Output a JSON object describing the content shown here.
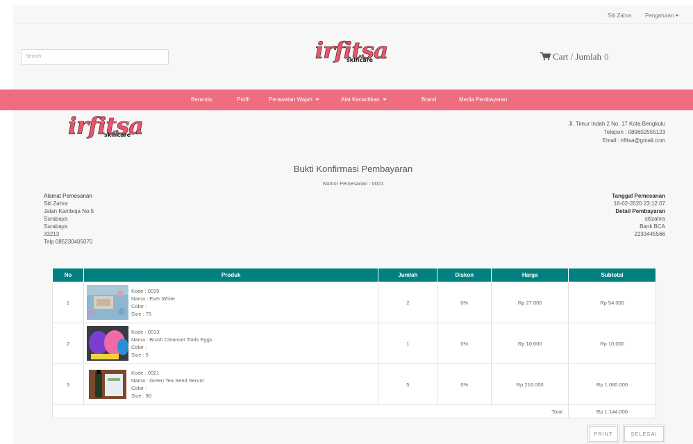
{
  "topbar": {
    "user": "Siti Zahra",
    "settings": "Pengaturan"
  },
  "header": {
    "search_placeholder": "Search",
    "logo_script": "irfitsa",
    "logo_sub": "skincare",
    "cart_label": "Cart / Jumlah",
    "cart_count": "0"
  },
  "nav": {
    "items": [
      "Beranda",
      "Profil",
      "Perawatan Wajah",
      "Alat Kecantikan",
      "Brand",
      "Media Pembayaran"
    ]
  },
  "store": {
    "address": "Jl. Timur Indah 2 No. 17 Kota Bengkulu",
    "phone": "Telepon : 089602555123",
    "email": "Email : irfitsa@gmail.com"
  },
  "receipt": {
    "title": "Bukti Konfirmasi Pembayaran",
    "order_number": "Nomor Pemesanan : 0001"
  },
  "shipping": {
    "heading": "Alamat Pemesanan",
    "lines": [
      "Siti Zahra",
      "Jalan Kamboja No.5",
      "Surabaya",
      "Surabaya",
      "33213",
      "Telp 085230405070"
    ]
  },
  "order_detail": {
    "date_heading": "Tanggal Pemesanan",
    "date": "18-02-2020 23:12:07",
    "payment_heading": "Detail Pembayaran",
    "account": "sitizahra",
    "bank": "Bank BCA",
    "account_no": "2233445566"
  },
  "table": {
    "headers": [
      "No",
      "Produk",
      "Jumlah",
      "Diskon",
      "Harga",
      "Subtotal"
    ],
    "rows": [
      {
        "no": "1",
        "kode": "Kode : 0035",
        "nama": "Nama : Ever White",
        "color": "Color :",
        "size": "Size : 75",
        "jumlah": "2",
        "diskon": "0%",
        "harga": "Rp 27.000",
        "subtotal": "Rp 54.000",
        "image": "ever-white-product-photo"
      },
      {
        "no": "2",
        "kode": "Kode : 0013",
        "nama": "Nama : Brush Cleanser Tools Eggs",
        "color": "Color :",
        "size": "Size : 5",
        "jumlah": "1",
        "diskon": "0%",
        "harga": "Rp 10.000",
        "subtotal": "Rp 10.000",
        "image": "brush-cleanser-eggs-photo"
      },
      {
        "no": "3",
        "kode": "Kode : 0021",
        "nama": "Nama : Green Tea Seed Serum",
        "color": "Color :",
        "size": "Size : 80",
        "jumlah": "5",
        "diskon": "0%",
        "harga": "Rp 216.000",
        "subtotal": "Rp 1.080.000",
        "image": "green-tea-serum-photo"
      }
    ],
    "total_label": "Total",
    "total_value": "Rp 1.144.000"
  },
  "buttons": {
    "print": "PRINT",
    "finish": "SELESAI"
  },
  "colors": {
    "nav": "#ee6d7f",
    "table_header": "#008080",
    "logo_script": "#e8556a"
  },
  "icons": [
    "cart-icon",
    "caret-down-icon"
  ]
}
